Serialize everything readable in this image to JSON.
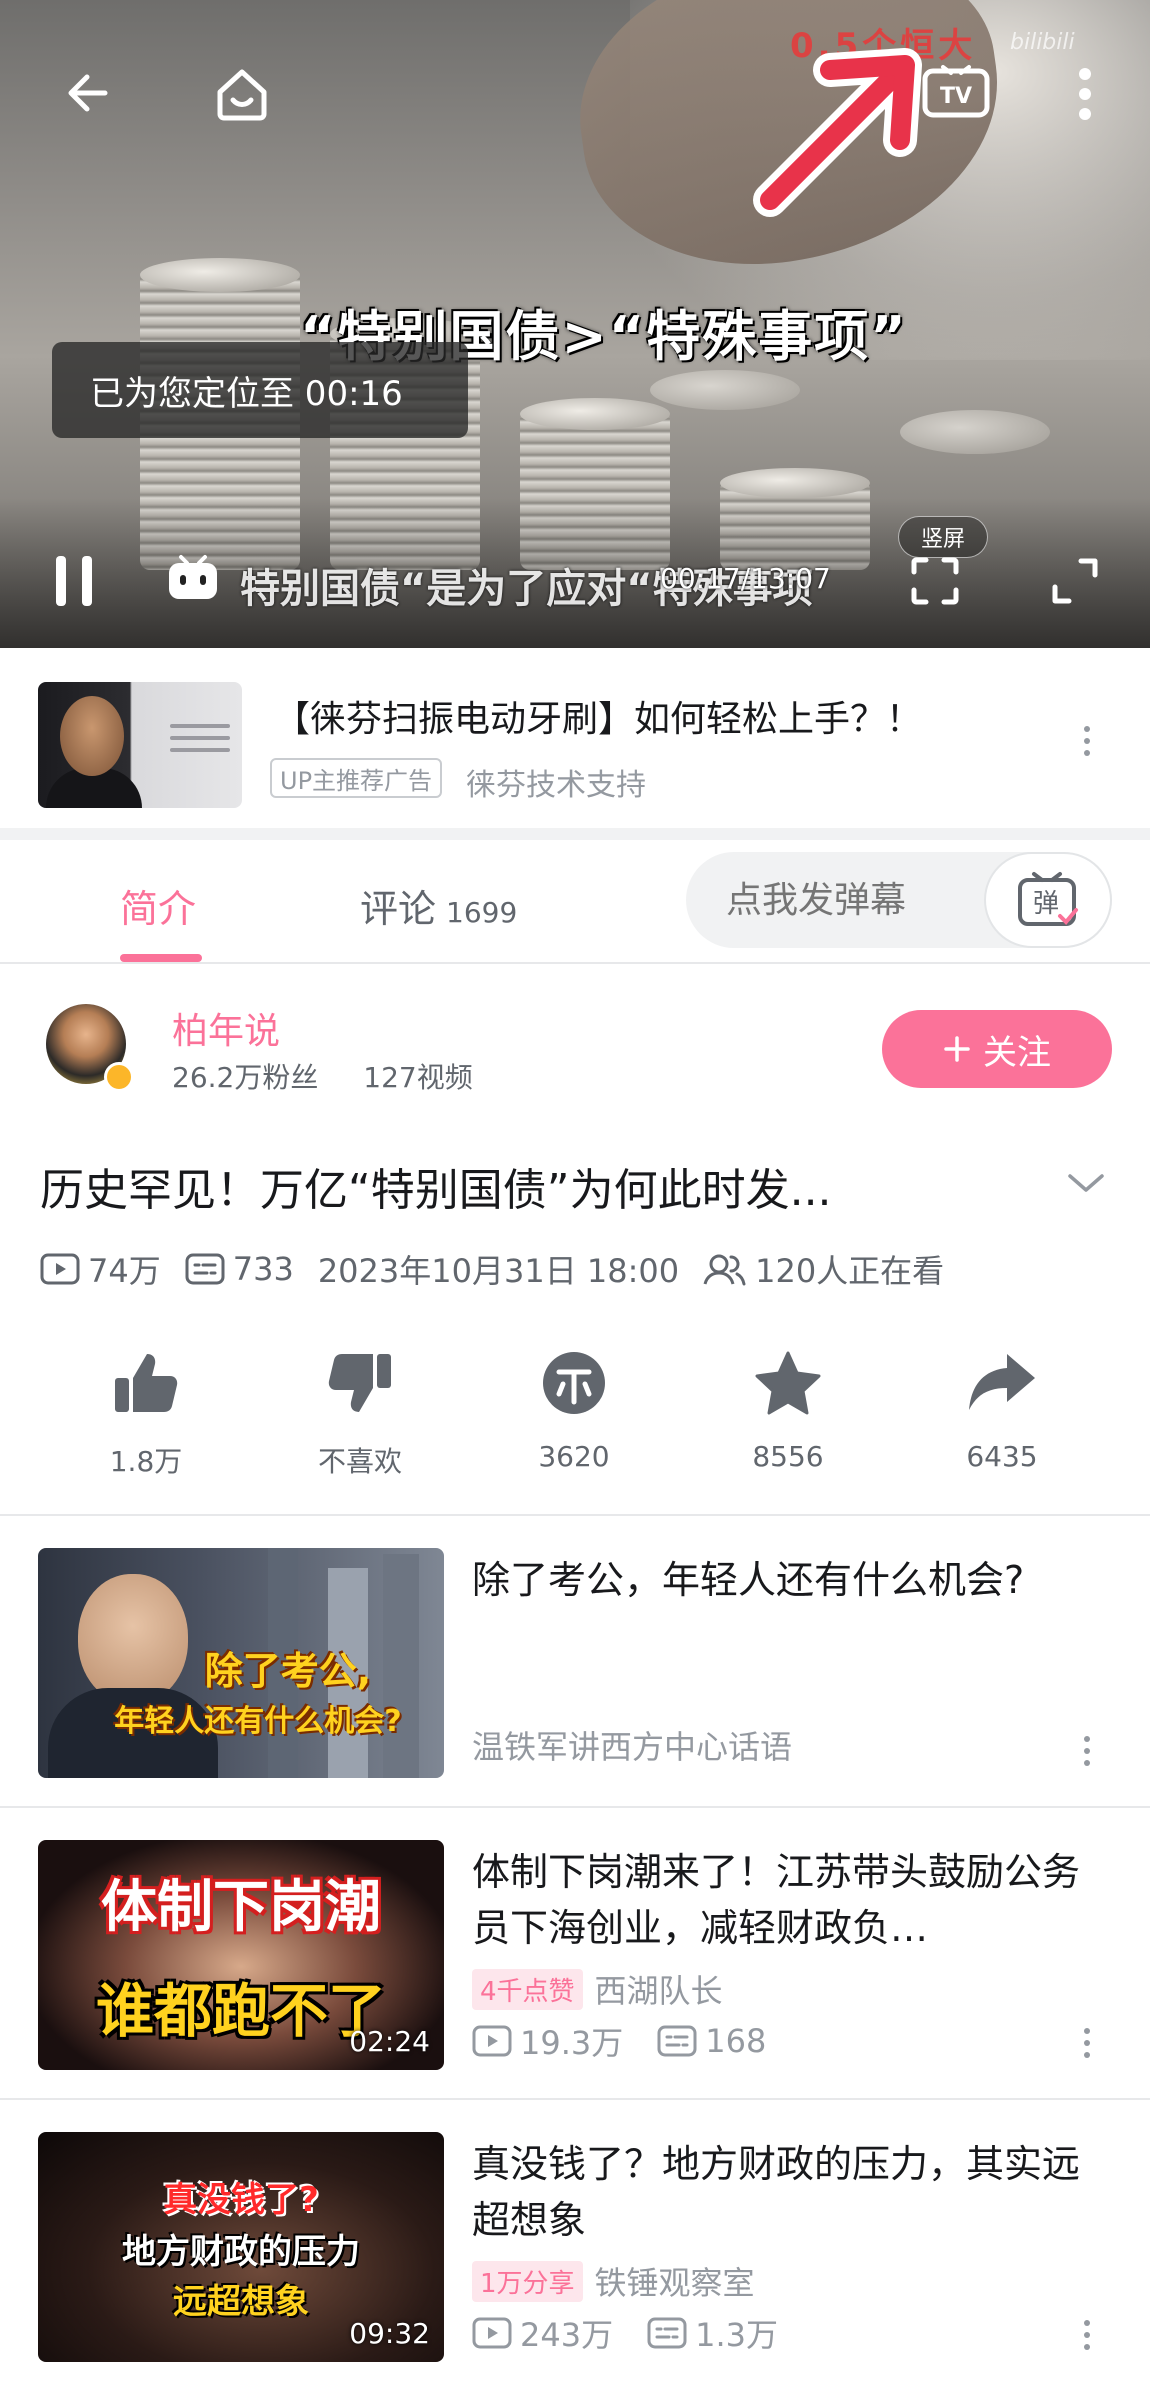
{
  "player": {
    "watermark_text": "0.5个恒大",
    "watermark_logo": "bilibili",
    "caption_top": "“特别国债>“特殊事项”",
    "caption_bottom": "特别国债“是为了应对“特殊事项",
    "toast": "已为您定位至 00:16",
    "time": "00:17/13:07",
    "vertical_label": "竖屏",
    "icons": [
      "back-icon",
      "home-icon",
      "tv-cast-icon",
      "more-icon",
      "pause-icon",
      "fullscreen-icon"
    ],
    "arrow_color": "#e8334a"
  },
  "ad": {
    "title": "【徕芬扫振电动牙刷】如何轻松上手？！",
    "tag": "UP主推荐广告",
    "source": "徕芬技术支持"
  },
  "tabs": {
    "intro": "简介",
    "comments": "评论",
    "comments_count": "1699",
    "danmaku_placeholder": "点我发弹幕",
    "danmaku_btn_icon": "弹"
  },
  "uploader": {
    "name": "柏年说",
    "fans": "26.2万粉丝",
    "videos": "127视频",
    "follow": "关注"
  },
  "video": {
    "title": "历史罕见！万亿“特别国债”为何此时发...",
    "views": "74万",
    "danmaku": "733",
    "date": "2023年10月31日 18:00",
    "watching": "120人正在看"
  },
  "actions": {
    "like": "1.8万",
    "dislike": "不喜欢",
    "coin": "3620",
    "favorite": "8556",
    "share": "6435"
  },
  "recommendations": [
    {
      "title": "除了考公，年轻人还有什么机会?",
      "author": "温铁军讲西方中心话语",
      "thumb_lines": [
        "除了考公,",
        "年轻人还有什么机会?"
      ]
    },
    {
      "title": "体制下岗潮来了！江苏带头鼓励公务员下海创业，减轻财政负…",
      "badge": "4千点赞",
      "author": "西湖队长",
      "views": "19.3万",
      "danmaku": "168",
      "duration": "02:24",
      "thumb_lines": [
        "体制下岗潮",
        "谁都跑不了"
      ]
    },
    {
      "title": "真没钱了？地方财政的压力，其实远超想象",
      "badge": "1万分享",
      "author": "铁锤观察室",
      "views": "243万",
      "danmaku": "1.3万",
      "duration": "09:32",
      "thumb_lines": [
        "真没钱了?",
        "地方财政的压力",
        "远超想象"
      ]
    }
  ],
  "colors": {
    "brand_pink": "#fb7299",
    "text_main": "#18191c",
    "text_sub": "#61666d",
    "text_muted": "#9499a0"
  }
}
